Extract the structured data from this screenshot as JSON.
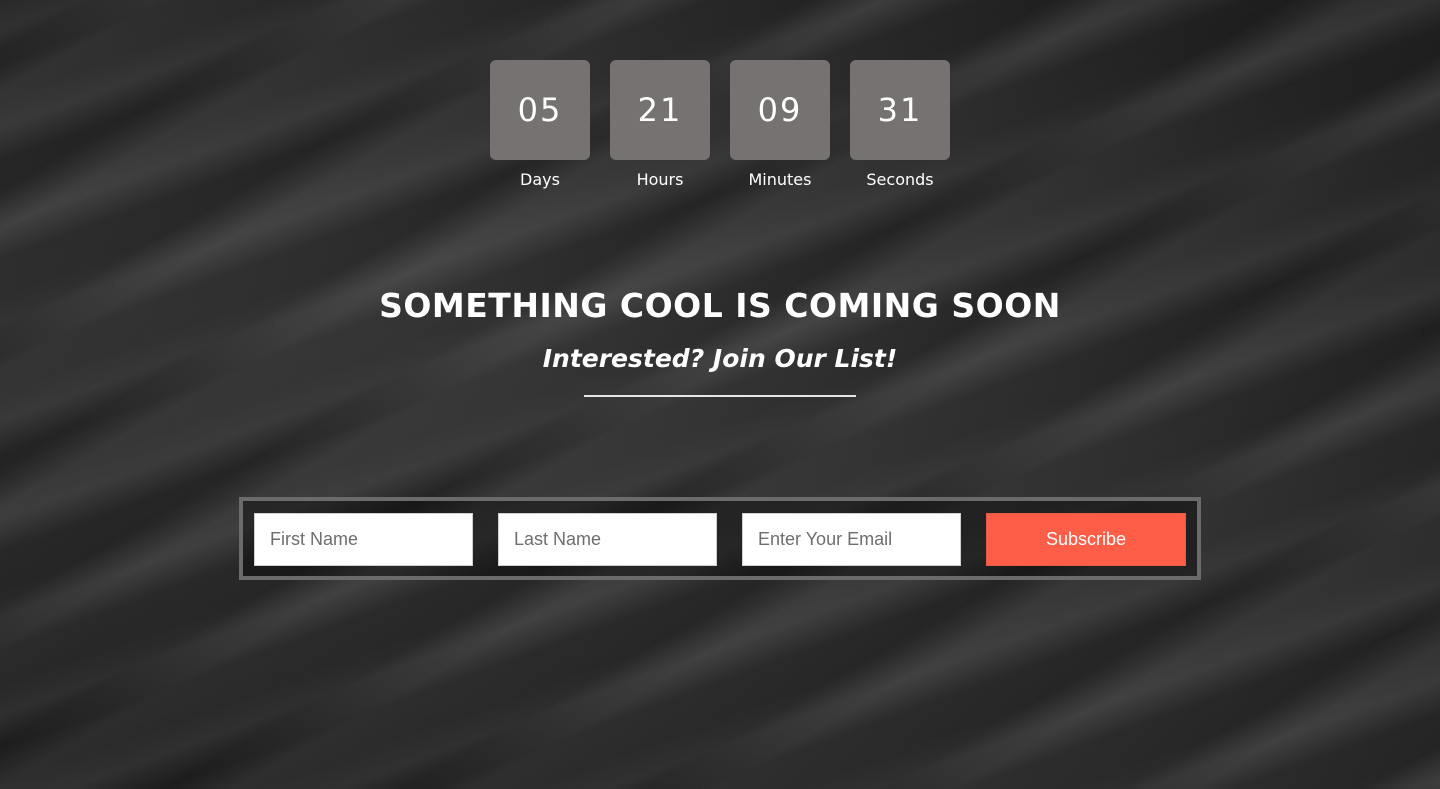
{
  "countdown": [
    {
      "value": "05",
      "label": "Days"
    },
    {
      "value": "21",
      "label": "Hours"
    },
    {
      "value": "09",
      "label": "Minutes"
    },
    {
      "value": "31",
      "label": "Seconds"
    }
  ],
  "headline": "SOMETHING COOL IS COMING SOON",
  "subheadline": "Interested? Join Our List!",
  "form": {
    "first_name_placeholder": "First Name",
    "last_name_placeholder": "Last Name",
    "email_placeholder": "Enter Your Email",
    "subscribe_label": "Subscribe"
  },
  "colors": {
    "accent": "#fe5d48",
    "countdown_box": "#757271",
    "background": "#262626"
  }
}
